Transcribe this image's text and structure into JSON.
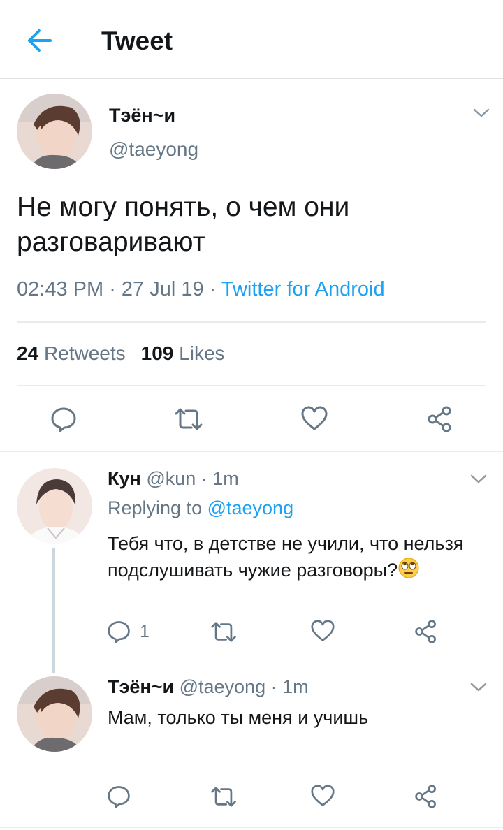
{
  "header": {
    "title": "Tweet"
  },
  "main_tweet": {
    "display_name": "Тэён~и",
    "handle": "@taeyong",
    "text": "Не могу понять, о чем они разговаривают",
    "time": "02:43 PM",
    "date": "27 Jul 19",
    "sep1": " · ",
    "sep2": " · ",
    "source": "Twitter for Android",
    "retweets_count": "24",
    "retweets_label": "Retweets",
    "likes_count": "109",
    "likes_label": "Likes"
  },
  "replies": [
    {
      "display_name": "Кун",
      "handle": "@kun",
      "time": "· 1m",
      "replying_prefix": "Replying to ",
      "replying_to": "@taeyong",
      "text": "Тебя что, в детстве не учили, что нельзя подслушивать чужие разговоры?",
      "emoji": "face-with-rolling-eyes",
      "reply_count": "1"
    },
    {
      "display_name": "Тэён~и",
      "handle": "@taeyong",
      "time": "· 1m",
      "text": "Мам, только ты меня и учишь"
    }
  ],
  "colors": {
    "accent": "#1da1f2",
    "secondary_text": "#657786",
    "icon": "#657786",
    "divider": "#e6ecf0"
  }
}
